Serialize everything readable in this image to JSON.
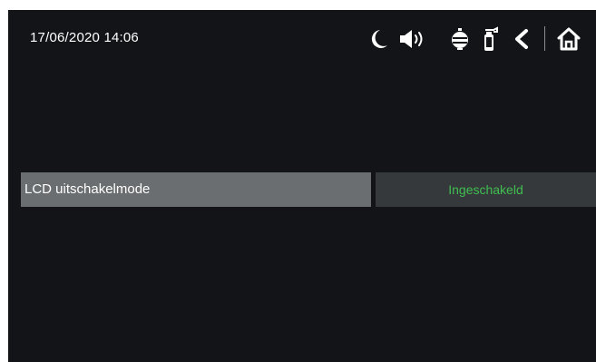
{
  "status_bar": {
    "datetime": "17/06/2020  14:06",
    "icons": [
      "moon-icon",
      "speaker-icon",
      "doorbell-icon",
      "fire-extinguisher-icon",
      "back-icon",
      "home-icon"
    ]
  },
  "setting": {
    "label": "LCD uitschakelmode",
    "value": "Ingeschakeld",
    "value_color": "#3fbf4f"
  },
  "colors": {
    "background": "#121418",
    "label_cell": "#6b6e70",
    "value_cell": "#36393c"
  }
}
